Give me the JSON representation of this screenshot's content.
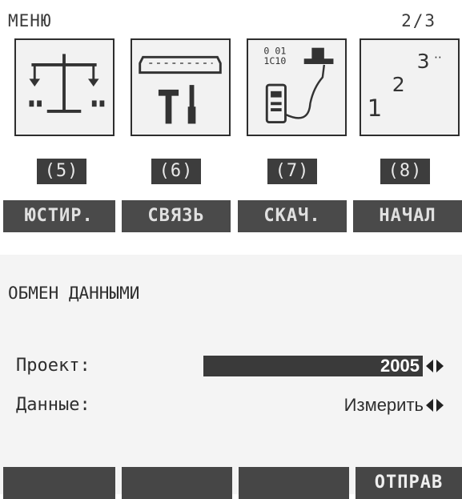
{
  "menu": {
    "title": "МЕНЮ",
    "page": "2/3",
    "tiles": [
      {
        "number": "(5)",
        "icon": "balance-scale-icon"
      },
      {
        "number": "(6)",
        "icon": "tools-icon"
      },
      {
        "number": "(7)",
        "icon": "data-transfer-icon"
      },
      {
        "number": "(8)",
        "icon": "initialize-123-icon"
      }
    ],
    "softkeys": [
      "ЮСТИР.",
      "СВЯЗЬ",
      "СКАЧ.",
      "НАЧАЛ"
    ],
    "tile_glyphs": {
      "binary_top": "0  01",
      "binary_bottom": "1C10",
      "num1": "1",
      "num2": "2",
      "num3": "3",
      "dots": "··"
    }
  },
  "exchange": {
    "title": "ОБМЕН ДАННЫМИ",
    "project_label": "Проект:",
    "project_value": "2005",
    "data_label": "Данные:",
    "data_value": "Измерить",
    "softkeys": [
      "",
      "",
      "",
      "ОТПРАВ"
    ]
  },
  "colors": {
    "softkey_bg": "#4a4a4a",
    "number_bg": "#3d3d3d",
    "selection_bg": "#3a3a3a",
    "screen_bg": "#f4f4f4"
  }
}
